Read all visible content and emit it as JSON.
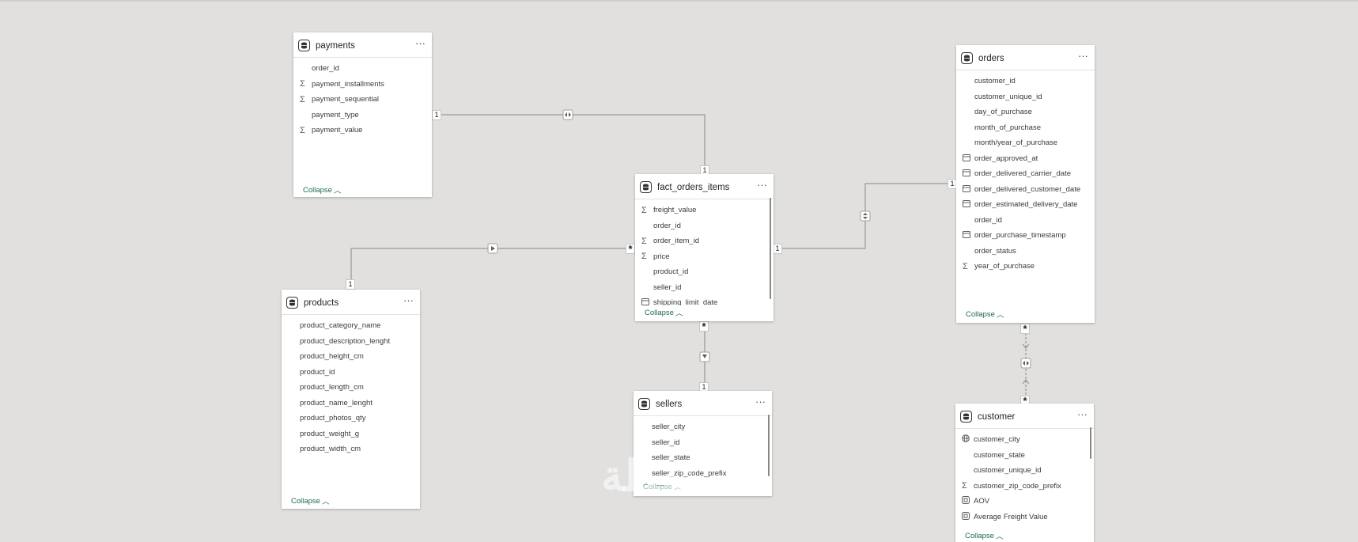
{
  "tables": {
    "payments": {
      "name": "payments",
      "fields": [
        {
          "name": "order_id",
          "icon": ""
        },
        {
          "name": "payment_installments",
          "icon": "sigma"
        },
        {
          "name": "payment_sequential",
          "icon": "sigma"
        },
        {
          "name": "payment_type",
          "icon": ""
        },
        {
          "name": "payment_value",
          "icon": "sigma"
        }
      ],
      "collapse": "Collapse"
    },
    "products": {
      "name": "products",
      "fields": [
        {
          "name": "product_category_name",
          "icon": ""
        },
        {
          "name": "product_description_lenght",
          "icon": ""
        },
        {
          "name": "product_height_cm",
          "icon": ""
        },
        {
          "name": "product_id",
          "icon": ""
        },
        {
          "name": "product_length_cm",
          "icon": ""
        },
        {
          "name": "product_name_lenght",
          "icon": ""
        },
        {
          "name": "product_photos_qty",
          "icon": ""
        },
        {
          "name": "product_weight_g",
          "icon": ""
        },
        {
          "name": "product_width_cm",
          "icon": ""
        }
      ],
      "collapse": "Collapse"
    },
    "fact_orders_items": {
      "name": "fact_orders_items",
      "fields": [
        {
          "name": "freight_value",
          "icon": "sigma"
        },
        {
          "name": "order_id",
          "icon": ""
        },
        {
          "name": "order_item_id",
          "icon": "sigma"
        },
        {
          "name": "price",
          "icon": "sigma"
        },
        {
          "name": "product_id",
          "icon": ""
        },
        {
          "name": "seller_id",
          "icon": ""
        },
        {
          "name": "shipping_limit_date",
          "icon": "calendar"
        }
      ],
      "collapse": "Collapse"
    },
    "sellers": {
      "name": "sellers",
      "fields": [
        {
          "name": "seller_city",
          "icon": ""
        },
        {
          "name": "seller_id",
          "icon": ""
        },
        {
          "name": "seller_state",
          "icon": ""
        },
        {
          "name": "seller_zip_code_prefix",
          "icon": ""
        }
      ],
      "collapse": "Collapse"
    },
    "orders": {
      "name": "orders",
      "fields": [
        {
          "name": "customer_id",
          "icon": ""
        },
        {
          "name": "customer_unique_id",
          "icon": ""
        },
        {
          "name": "day_of_purchase",
          "icon": ""
        },
        {
          "name": "month_of_purchase",
          "icon": ""
        },
        {
          "name": "month/year_of_purchase",
          "icon": ""
        },
        {
          "name": "order_approved_at",
          "icon": "calendar"
        },
        {
          "name": "order_delivered_carrier_date",
          "icon": "calendar"
        },
        {
          "name": "order_delivered_customer_date",
          "icon": "calendar"
        },
        {
          "name": "order_estimated_delivery_date",
          "icon": "calendar"
        },
        {
          "name": "order_id",
          "icon": ""
        },
        {
          "name": "order_purchase_timestamp",
          "icon": "calendar"
        },
        {
          "name": "order_status",
          "icon": ""
        },
        {
          "name": "year_of_purchase",
          "icon": "sigma"
        }
      ],
      "collapse": "Collapse"
    },
    "customer": {
      "name": "customer",
      "fields": [
        {
          "name": "customer_city",
          "icon": "globe"
        },
        {
          "name": "customer_state",
          "icon": ""
        },
        {
          "name": "customer_unique_id",
          "icon": ""
        },
        {
          "name": "customer_zip_code_prefix",
          "icon": "sigma"
        },
        {
          "name": "AOV",
          "icon": "measure"
        },
        {
          "name": "Average Freight Value",
          "icon": "measure"
        }
      ],
      "collapse": "Collapse"
    }
  },
  "cardinality": {
    "one": "1",
    "many": "*"
  },
  "colors": {
    "canvas": "#e1e0df",
    "link": "#8a8886",
    "collapse": "#1e6b4e"
  },
  "icons": {
    "table": "table-icon",
    "more": "more-options-icon",
    "sigma": "sigma-icon",
    "calendar": "calendar-icon",
    "globe": "globe-icon",
    "measure": "measure-icon",
    "chevron": "chevron-up-icon"
  }
}
